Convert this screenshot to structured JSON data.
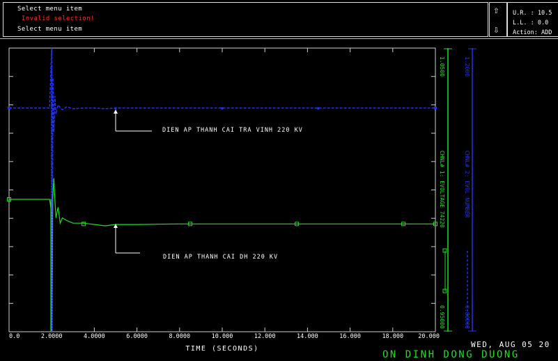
{
  "header": {
    "messages": [
      "Select menu item",
      "Invalid selection!",
      "Select menu item"
    ],
    "ur_label": "U.R. :",
    "ur_value": "10.5",
    "ll_label": "L.L. :",
    "ll_value": "0.0",
    "action_label": "Action:",
    "action_value": "ADD"
  },
  "footer": {
    "date": "WED, AUG 05 20",
    "title": "ON DINH DONG DUONG"
  },
  "colors": {
    "green": "#22dd22",
    "blue": "#2233ee",
    "frame": "#cfcfcf",
    "error": "#ff2a2a"
  },
  "chart_data": {
    "type": "line",
    "xlabel": "TIME (SECONDS)",
    "xlim": [
      0,
      20
    ],
    "x_ticks": [
      "0.0",
      "2.0000",
      "4.0000",
      "6.0000",
      "8.0000",
      "10.000",
      "12.000",
      "14.000",
      "16.000",
      "18.000",
      "20.000"
    ],
    "axes": [
      {
        "name": "green_axis",
        "top_label": "1.0500",
        "bottom_label": "0.95000",
        "title": "CHNL# 1: EVOLTAGE 74220",
        "ylim": [
          0.95,
          1.05
        ]
      },
      {
        "name": "blue_axis",
        "top_label": "1.2000",
        "bottom_label": "0.80000",
        "title": "CHNL# 2: EVOL NUMBER",
        "ylim": [
          0.8,
          1.2
        ]
      }
    ],
    "series": [
      {
        "name": "CHNL# 2",
        "color": "#2233ee",
        "x": [
          0,
          1.9,
          2.0,
          2.03,
          2.06,
          2.1,
          2.15,
          2.2,
          2.3,
          2.5,
          2.7,
          3.0,
          3.5,
          4.0,
          4.5,
          5.0,
          6.0,
          8.0,
          10,
          12,
          14,
          16,
          18,
          20
        ],
        "y": [
          1.1,
          1.1,
          1.2,
          0.82,
          1.15,
          1.06,
          1.12,
          1.09,
          1.105,
          1.097,
          1.102,
          1.099,
          1.1,
          1.1,
          1.099,
          1.1,
          1.1,
          1.1,
          1.1,
          1.1,
          1.1,
          1.1,
          1.1,
          1.1
        ]
      },
      {
        "name": "CHNL# 1",
        "color": "#22dd22",
        "x": [
          0,
          1.9,
          2.0,
          2.02,
          2.05,
          2.1,
          2.15,
          2.2,
          2.3,
          2.4,
          2.5,
          2.7,
          3.0,
          3.5,
          4.0,
          4.5,
          5.0,
          6.0,
          8.0,
          10,
          12,
          14,
          16,
          18,
          20
        ],
        "y": [
          1.0,
          1.0,
          0.995,
          0.95,
          1.0,
          1.008,
          1.0,
          0.993,
          0.997,
          0.991,
          0.993,
          0.992,
          0.991,
          0.991,
          0.9905,
          0.99,
          0.9905,
          0.9905,
          0.9907,
          0.9907,
          0.9907,
          0.9907,
          0.9907,
          0.9907,
          0.9907
        ]
      }
    ],
    "markers_green_x": [
      3.5,
      8.5,
      13.5,
      18.5
    ],
    "annotations": [
      {
        "text": "DIEN AP THANH CAI TRA VINH 220 KV",
        "series": "CHNL# 2"
      },
      {
        "text": "DIEN AP THANH CAI DH 220 KV",
        "series": "CHNL# 1"
      }
    ]
  }
}
